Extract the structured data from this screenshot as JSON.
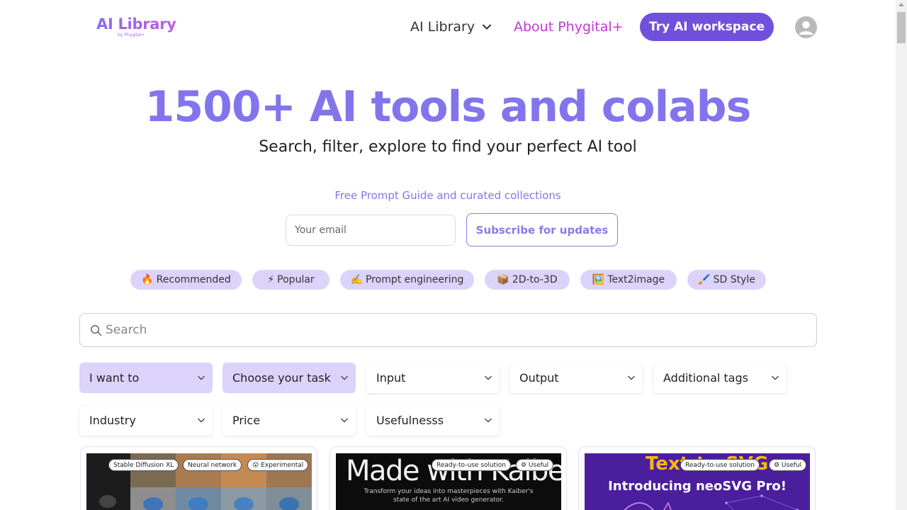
{
  "header": {
    "logo_main": "AI Library",
    "logo_sub": "by Phygital+",
    "nav_library": "AI Library",
    "nav_about": "About Phygital+",
    "cta": "Try AI workspace"
  },
  "hero": {
    "title": "1500+ AI tools and colabs",
    "subtitle": "Search, filter, explore to find your perfect AI tool",
    "promo": "Free Prompt Guide and curated collections",
    "email_placeholder": "Your email",
    "subscribe_label": "Subscribe for updates"
  },
  "chips": [
    {
      "icon": "🔥",
      "label": "Recommended"
    },
    {
      "icon": "⚡",
      "label": "Popular"
    },
    {
      "icon": "✍️",
      "label": "Prompt engineering"
    },
    {
      "icon": "📦",
      "label": "2D-to-3D"
    },
    {
      "icon": "🖼️",
      "label": "Text2image"
    },
    {
      "icon": "🖌️",
      "label": "SD Style"
    }
  ],
  "search": {
    "placeholder": "Search"
  },
  "filters": [
    {
      "label": "I want to",
      "active": true
    },
    {
      "label": "Choose your task",
      "active": true
    },
    {
      "label": "Input",
      "active": false
    },
    {
      "label": "Output",
      "active": false
    },
    {
      "label": "Additional tags",
      "active": false
    },
    {
      "label": "Industry",
      "active": false
    },
    {
      "label": "Price",
      "active": false
    },
    {
      "label": "Usefulnesss",
      "active": false
    }
  ],
  "cards": [
    {
      "tags": [
        "Stable Diffusion XL",
        "Neural network",
        "😮 Experimental"
      ]
    },
    {
      "tags": [
        "Ready-to-use solution",
        "⚙ Useful"
      ],
      "image_title": "Made with Kaiber",
      "image_text_1": "Transform your ideas into masterpieces with Kaiber's",
      "image_text_2": "state of the art AI video generator."
    },
    {
      "tags": [
        "Ready-to-use solution",
        "⚙ Useful"
      ],
      "image_top": "Text-to-SVG",
      "image_title": "Introducing neoSVG Pro!"
    }
  ],
  "colors": {
    "accent": "#7150dd",
    "hero_title": "#8275ec",
    "about_link": "#c535d6",
    "chip_bg": "#dcd3fb"
  }
}
